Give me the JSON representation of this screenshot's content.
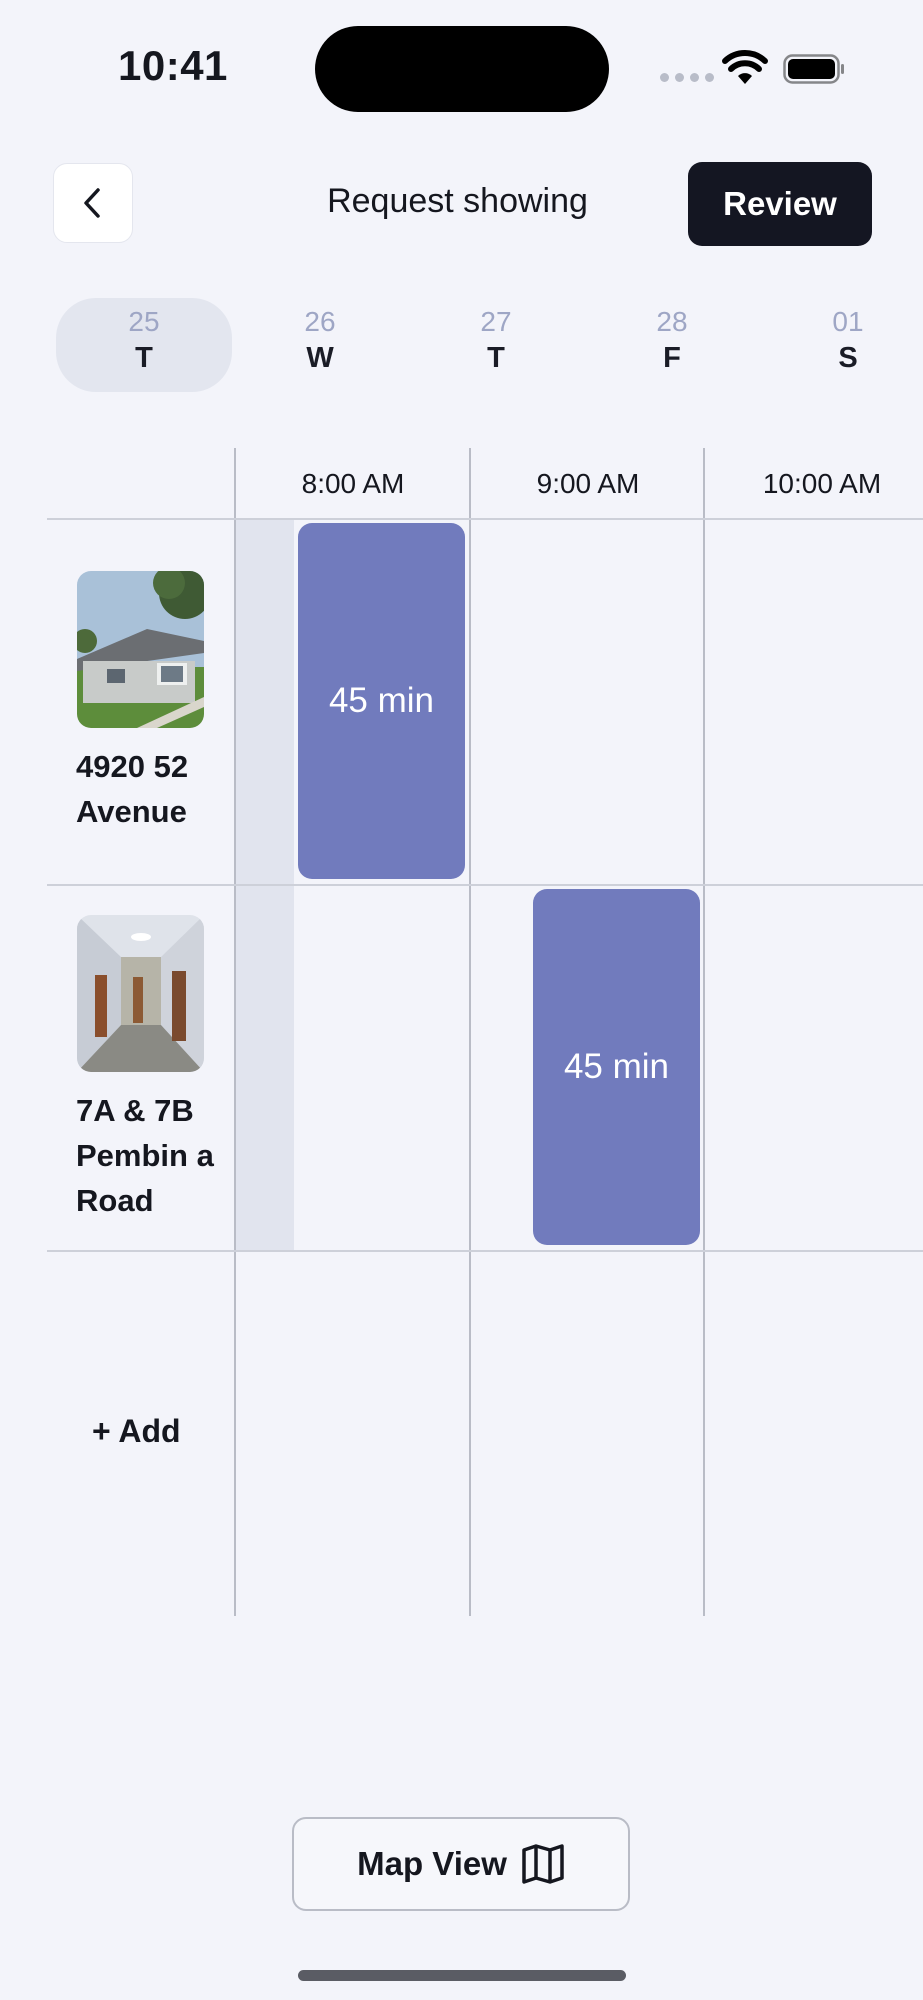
{
  "status_bar": {
    "time": "10:41"
  },
  "header": {
    "title": "Request showing",
    "review_label": "Review"
  },
  "days": [
    {
      "num": "25",
      "letter": "T",
      "selected": true
    },
    {
      "num": "26",
      "letter": "W",
      "selected": false
    },
    {
      "num": "27",
      "letter": "T",
      "selected": false
    },
    {
      "num": "28",
      "letter": "F",
      "selected": false
    },
    {
      "num": "01",
      "letter": "S",
      "selected": false
    }
  ],
  "time_columns": [
    "8:00 AM",
    "9:00 AM",
    "10:00 AM"
  ],
  "properties": [
    {
      "name": "4920 52 Avenue",
      "slot_label": "45 min"
    },
    {
      "name": "7A & 7B Pembin a Road",
      "slot_label": "45 min"
    }
  ],
  "add_label": "+ Add",
  "map_view_label": "Map View",
  "colors": {
    "accent": "#717bbd",
    "dark": "#141622",
    "background": "#f3f4fa"
  }
}
